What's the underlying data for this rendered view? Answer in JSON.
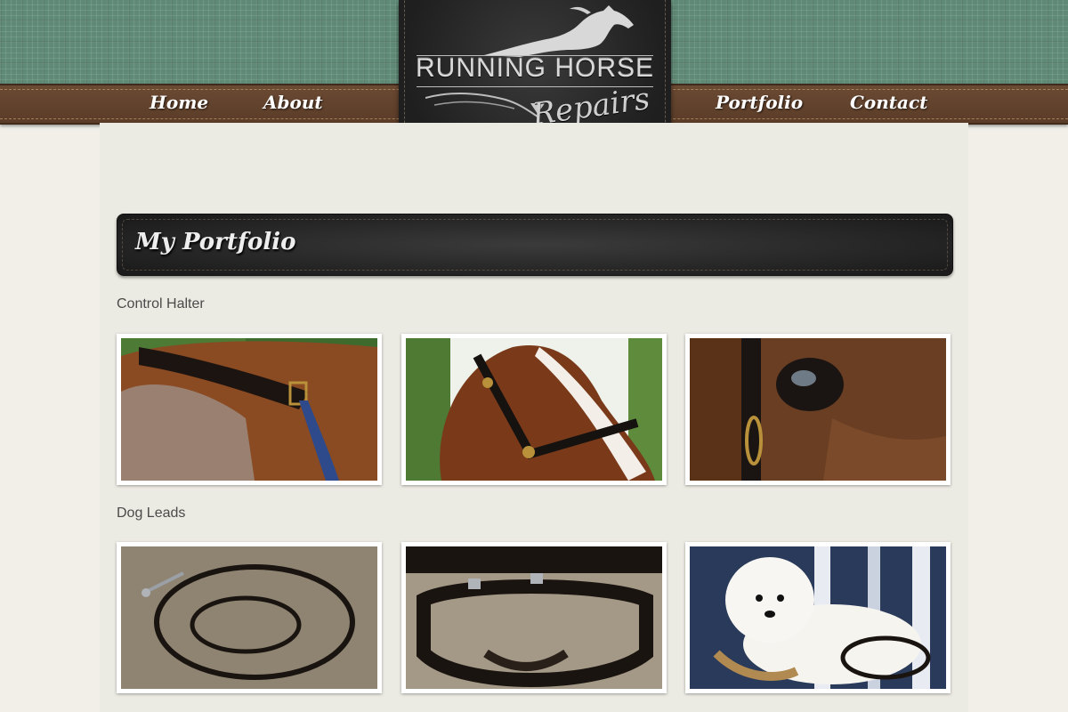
{
  "site": {
    "logo": {
      "title": "RUNNING HORSE",
      "subtitle": "Repairs"
    },
    "nav": {
      "home": "Home",
      "about": "About",
      "portfolio": "Portfolio",
      "contact": "Contact"
    }
  },
  "page": {
    "heading": "My Portfolio"
  },
  "sections": [
    {
      "label": "Control Halter"
    },
    {
      "label": "Dog Leads"
    }
  ],
  "colors": {
    "plaid": "#5f8a76",
    "nav_leather": "#6b4a33",
    "leather_dark": "#1f1f1f",
    "page_bg": "#ecebe3"
  }
}
